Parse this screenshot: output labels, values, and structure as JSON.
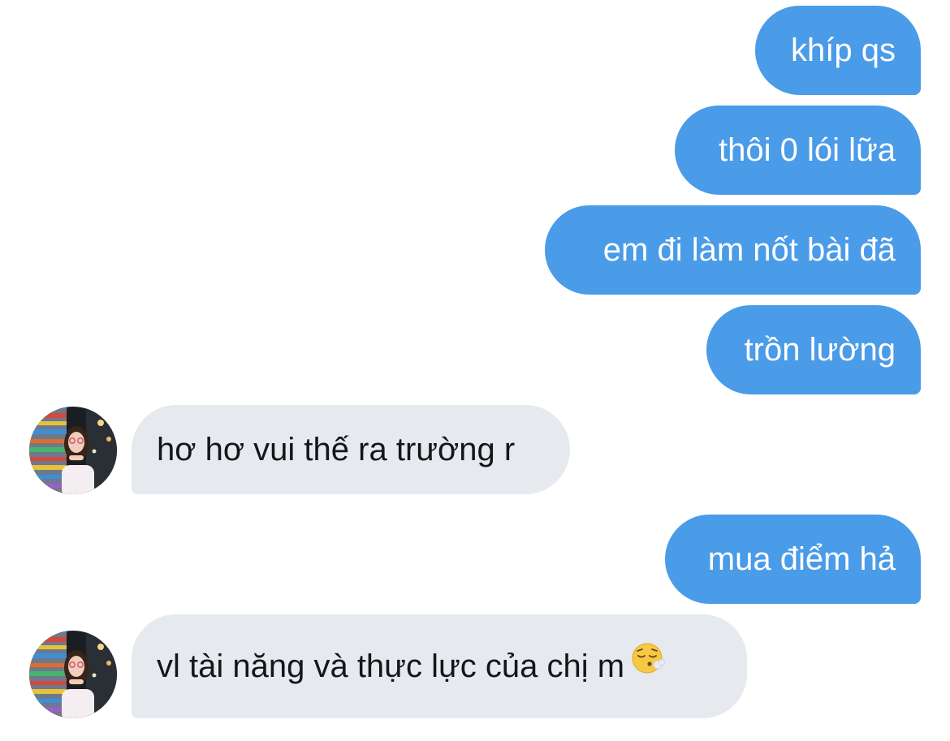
{
  "messages": [
    {
      "direction": "outgoing",
      "text": "khíp qs"
    },
    {
      "direction": "outgoing",
      "text": "thôi 0 lói lữa"
    },
    {
      "direction": "outgoing",
      "text": "em đi làm nốt bài đã"
    },
    {
      "direction": "outgoing",
      "text": "trồn lường"
    },
    {
      "direction": "incoming",
      "text": "hơ hơ vui thế ra trường r",
      "avatar": "contact-avatar"
    },
    {
      "direction": "outgoing",
      "text": "mua điểm hả"
    },
    {
      "direction": "incoming",
      "text": "vl tài năng và thực lực của chị m",
      "avatar": "contact-avatar",
      "emoji": "face-exhaling-emoji"
    }
  ],
  "colors": {
    "outgoing_bubble": "#4a9be8",
    "outgoing_text": "#ffffff",
    "incoming_bubble": "#e6e9ed",
    "incoming_text": "#14171a",
    "background": "#ffffff"
  }
}
